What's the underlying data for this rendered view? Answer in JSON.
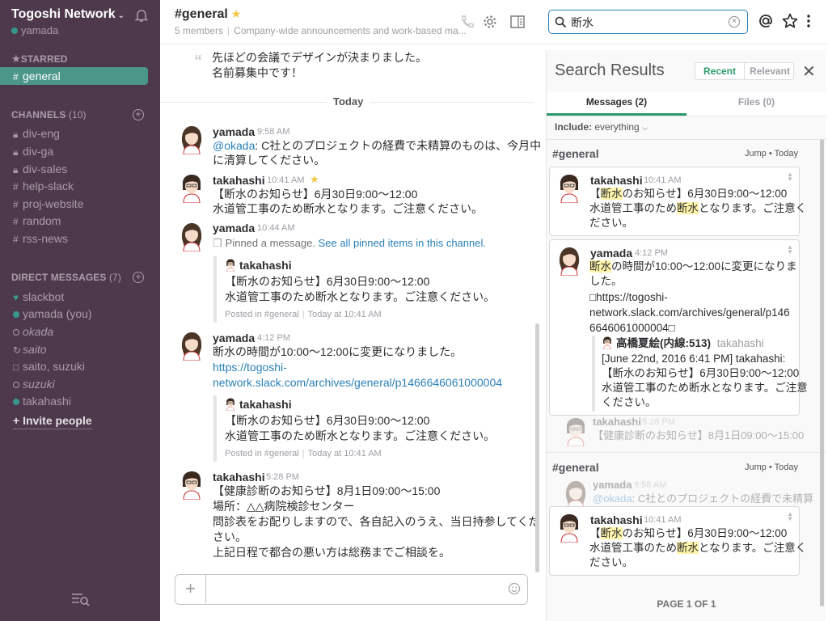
{
  "sidebar": {
    "team_name": "Togoshi Network",
    "current_user": "yamada",
    "starred_label": "STARRED",
    "starred": [
      "general"
    ],
    "channels_label": "CHANNELS",
    "channels_count": "(10)",
    "channels": [
      "div-eng",
      "div-ga",
      "div-sales",
      "help-slack",
      "proj-website",
      "random",
      "rss-news"
    ],
    "dm_label": "DIRECT MESSAGES",
    "dm_count": "(7)",
    "dms": [
      "slackbot",
      "yamada (you)",
      "okada",
      "saito",
      "saito, suzuki",
      "suzuki",
      "takahashi"
    ],
    "invite": "+ Invite people"
  },
  "header": {
    "channel": "#general",
    "members": "5 members",
    "purpose": "Company-wide announcements and work-based ma...",
    "search_query": "断水"
  },
  "messages": {
    "top_line1": "先ほどの会議でデザインが決まりました。",
    "top_line2": "名前募集中です！",
    "day": "Today",
    "m1_user": "yamada",
    "m1_time": "9:58 AM",
    "m1_mention": "@okada",
    "m1_line1": ": C社とのプロジェクトの経費で未精算のものは、今月中",
    "m1_line2": "に清算してください。",
    "m2_user": "takahashi",
    "m2_time": "10:41 AM",
    "m2_line1": "【断水のお知らせ】6月30日9:00～12:00",
    "m2_line2": "水道管工事のため断水となります。ご注意ください。",
    "m3_user": "yamada",
    "m3_time": "10:44 AM",
    "m3_pinned": "Pinned a message.",
    "m3_pinned_link": "See all pinned items in this channel.",
    "att1_user": "takahashi",
    "att1_line1": "【断水のお知らせ】6月30日9:00～12:00",
    "att1_line2": "水道管工事のため断水となります。ご注意ください。",
    "att1_posted": "Posted in #general",
    "att1_when": "Today at 10:41 AM",
    "m4_user": "yamada",
    "m4_time": "4:12 PM",
    "m4_line1": "断水の時間が10:00～12:00に変更になりました。",
    "m4_link1": "https://togoshi-",
    "m4_link2": "network.slack.com/archives/general/p1466646061000004",
    "att2_user": "takahashi",
    "att2_line1": "【断水のお知らせ】6月30日9:00～12:00",
    "att2_line2": "水道管工事のため断水となります。ご注意ください。",
    "att2_posted": "Posted in #general",
    "att2_when": "Today at 10:41 AM",
    "m5_user": "takahashi",
    "m5_time": "5:28 PM",
    "m5_line1": "【健康診断のお知らせ】8月1日09:00～15:00",
    "m5_line2": "場所：△△病院検診センター",
    "m5_line3": "問診表をお配りしますので、各自記入のうえ、当日持参してくだ",
    "m5_line4": "さい。",
    "m5_line5": "上記日程で都合の悪い方は総務までご相談を。"
  },
  "search_panel": {
    "title": "Search Results",
    "recent": "Recent",
    "relevant": "Relevant",
    "tab_messages": "Messages (2)",
    "tab_files": "Files (0)",
    "include_label": "Include:",
    "include_value": "everything",
    "g1_channel": "#general",
    "jump": "Jump",
    "today": "Today",
    "r1_user": "takahashi",
    "r1_time": "10:41 AM",
    "r1_a": "【",
    "r1_hl": "断水",
    "r1_b": "のお知らせ】6月30日9:00～12:00",
    "r1_c": "水道管工事のため",
    "r1_hl2": "断水",
    "r1_d": "となります。ご注意く",
    "r1_e": "ださい。",
    "r2_user": "yamada",
    "r2_time": "4:12 PM",
    "r2_hl": "断水",
    "r2_a": "の時間が10:00～12:00に変更になりま",
    "r2_b": "した。",
    "r2_c": "□https://togoshi-",
    "r2_d": "network.slack.com/archives/general/p146",
    "r2_e": "6646061000004□",
    "r2_q_user": "高橋夏絵(内線:513)",
    "r2_q_handle": "takahashi",
    "r2_q1": "[June 22nd, 2016 6:41 PM] takahashi:",
    "r2_q2": "【断水のお知らせ】6月30日9:00～12:00",
    "r2_q3": "水道管工事のため断水となります。ご注意",
    "r2_q4": "ください。",
    "ctx1_user": "takahashi",
    "ctx1_time": "5:28 PM",
    "ctx1_line": "【健康診断のお知らせ】8月1日09:00～15:00",
    "g2_channel": "#general",
    "ctx2_user": "yamada",
    "ctx2_time": "9:58 AM",
    "ctx2_mention": "@okada",
    "ctx2_line": ": C社とのプロジェクトの経費で未精算",
    "r3_user": "takahashi",
    "r3_time": "10:41 AM",
    "r3_a": "【",
    "r3_hl": "断水",
    "r3_b": "のお知らせ】6月30日9:00～12:00",
    "r3_c": "水道管工事のため",
    "r3_hl2": "断水",
    "r3_d": "となります。ご注意く",
    "r3_e": "ださい。",
    "footer": "PAGE 1 OF 1"
  },
  "colors": {
    "sidebar_bg": "#4d394b",
    "active": "#4c9689",
    "link": "#2a80b9",
    "highlight": "#fff4a8"
  }
}
